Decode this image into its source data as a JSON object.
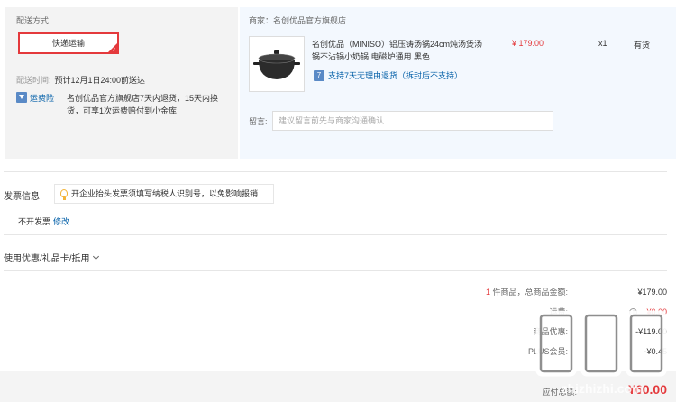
{
  "shipping": {
    "title": "配送方式",
    "method": "快递运输",
    "time_label": "配送时间:",
    "time_value": "预计12月1日24:00前送达",
    "insurance_label": "运费险",
    "insurance_text": "名创优品官方旗舰店7天内退货，15天内换货，可享1次运费赔付到小金库"
  },
  "store": {
    "name": "商家：名创优品官方旗舰店"
  },
  "product": {
    "title": "名创优品（MINISO）铝压铸汤锅24cm炖汤煲汤锅不沾锅小奶锅 电磁炉通用 黑色",
    "price": "¥ 179.00",
    "qty": "x1",
    "stock": "有货",
    "return_icon": "7",
    "return_policy": "支持7天无理由退货（拆封后不支持）"
  },
  "message": {
    "label": "留言:",
    "placeholder": "建议留言前先与商家沟通确认"
  },
  "invoice": {
    "title": "发票信息",
    "tip": "开企业抬头发票须填写纳税人识别号，以免影响报销",
    "value": "不开发票",
    "edit": "修改"
  },
  "discount": {
    "title": "使用优惠/礼品卡/抵用"
  },
  "summary": {
    "count": "1",
    "count_suffix": "件商品，总商品金额:",
    "total": "¥179.00",
    "freight_label": "运费:",
    "freight": "¥0.00",
    "promo_label": "商品优惠:",
    "promo": "-¥119.00",
    "plus_label": "PLUS会员:",
    "plus": "-¥0.45",
    "payable_label": "应付总额:",
    "payable": "¥60.00"
  },
  "watermark": {
    "text": "值 | 值 | 值",
    "domain": "zhizhizhi.com"
  },
  "colors": {
    "accent_red": "#e4393c",
    "link_blue": "#005ea7"
  }
}
